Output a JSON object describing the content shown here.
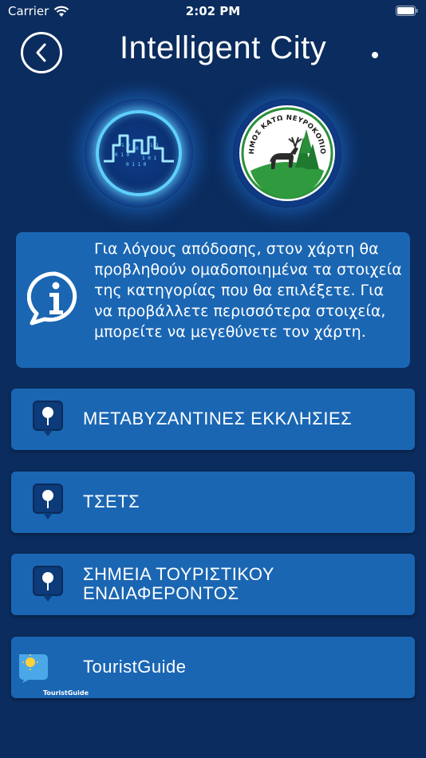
{
  "status_bar": {
    "carrier": "Carrier",
    "time": "2:02 PM"
  },
  "header": {
    "title": "Intelligent City"
  },
  "logos": {
    "municipality_text": "ΔΗΜΟΣ ΚΑΤΩ ΝΕΥΡΟΚΟΠΙΟΥ"
  },
  "info": {
    "text": "Για λόγους απόδοσης, στον χάρτη θα προβληθούν ομαδοποιημένα τα στοιχεία της κατηγορίας που θα επιλέξετε. Για να προβάλλετε περισσότερα στοιχεία, μπορείτε να μεγεθύνετε τον χάρτη."
  },
  "menu": {
    "items": [
      {
        "label": "ΜΕΤΑΒΥΖΑΝΤΙΝΕΣ ΕΚΚΛΗΣΙΕΣ",
        "icon": "map-pin-icon"
      },
      {
        "label": "ΤΣΕΤΣ",
        "icon": "map-pin-icon"
      },
      {
        "label_line1": "ΣΗΜΕΙΑ ΤΟΥΡΙΣΤΙΚΟΥ",
        "label_line2": "ΕΝΔΙΑΦΕΡΟΝΤΟΣ",
        "icon": "map-pin-icon"
      },
      {
        "label": "TouristGuide",
        "icon": "tourist-guide-icon",
        "icon_text": "TouristGuide"
      }
    ]
  },
  "colors": {
    "background": "#0b2c5e",
    "card": "#1a66b3",
    "accent": "#5fd0ff"
  }
}
